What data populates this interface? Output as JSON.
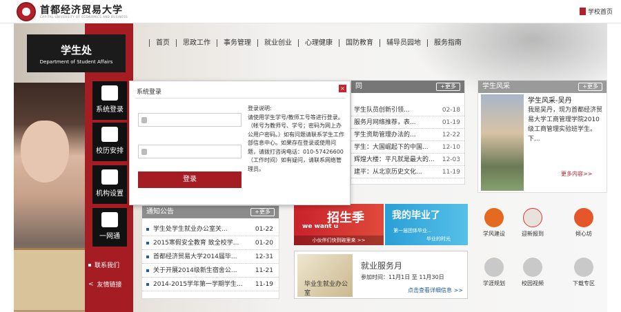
{
  "header": {
    "title": "首都经济贸易大学",
    "subtitle": "CAPITAL UNIVERSITY OF ECONOMICS AND BUSINESS",
    "home_link": "学校首页"
  },
  "dept": {
    "name_cn": "学生处",
    "name_en": "Department of Student Affairs"
  },
  "nav": [
    "首页",
    "思政工作",
    "事务管理",
    "就业创业",
    "心理健康",
    "国防教育",
    "辅导员园地",
    "服务指南"
  ],
  "side_menu": [
    {
      "label": "系统登录",
      "icon": "user-login-icon"
    },
    {
      "label": "校历安排",
      "icon": "calendar-icon"
    },
    {
      "label": "机构设置",
      "icon": "org-user-icon"
    },
    {
      "label": "一网通",
      "icon": "clover-icon"
    }
  ],
  "side_links": [
    "联系我们",
    "友情链接"
  ],
  "news": {
    "more": "+更多",
    "items": [
      {
        "title": "学生队员创新引领...",
        "date": "02-18"
      },
      {
        "title": "服务月网络推荐，表...",
        "date": "01-19"
      },
      {
        "title": "学生资助管理办法的...",
        "date": "12-22"
      },
      {
        "title": "学生：大国崛起下的中国...",
        "date": "12-10"
      },
      {
        "title": "辉煌大楼：平凡就是最大的...",
        "date": "12-03"
      },
      {
        "title": "建平：从北京历史文化...",
        "date": "11-19"
      }
    ]
  },
  "notice": {
    "title": "通知公告",
    "more": "+更多",
    "items": [
      {
        "title": "学生处学生就业办公室关...",
        "date": "01-22"
      },
      {
        "title": "2015寒假安全教育 致全校学...",
        "date": "01-20"
      },
      {
        "title": "首都经济贸易大学2014届毕...",
        "date": "12-31"
      },
      {
        "title": "关于开展2014级新生宿舍公...",
        "date": "11-21"
      },
      {
        "title": "2014-2015学年第一学期学生...",
        "date": "11-19"
      }
    ]
  },
  "profile": {
    "title": "学生风采",
    "more": "+更多",
    "name": "学生风采-吴丹",
    "text": "我是吴丹，现为首都经济贸易大学工商管理学院2010级工商管理实验班学生。下...",
    "link": "更多内容>>"
  },
  "banners": {
    "recruit_big": "招生季",
    "recruit_sm": "we want u",
    "recruit_bot": "小伙伴们快到碗里来 >>",
    "grad_big": "我的毕业了",
    "grad_sm": "第一届团体毕业...",
    "grad_sm2": "毕业的时光"
  },
  "job_fair": {
    "pic_text": "毕业生就业办公室",
    "title": "就业服务月",
    "when": "参加时间：11月1日 至 11月30日",
    "link": "点击查看详细信息 >>"
  },
  "tiles": [
    {
      "label": "学风建设",
      "icon": "pen-icon",
      "color": "#e36a1e"
    },
    {
      "label": "迎新报到",
      "icon": "welcome-icon",
      "color": "#e8e2dc"
    },
    {
      "label": "倾心坊",
      "icon": "heart-icon",
      "color": "#e5572b"
    },
    {
      "label": "学涯规划",
      "icon": "chart-icon",
      "color": "#c9c9c9"
    },
    {
      "label": "校园视频",
      "icon": "play-icon",
      "color": "#c9c9c9"
    },
    {
      "label": "下载专区",
      "icon": "download-icon",
      "color": "#c9c9c9"
    }
  ],
  "login": {
    "title": "系统登录",
    "close": "×",
    "username_placeholder": "",
    "password_placeholder": "",
    "button": "登录",
    "help_title": "登录说明:",
    "help_text": "请使用学生学号/教师工号等进行登录。（帐号为教师号、学号；密码为网上办公用户密码。）如有问题请联系学生工作部信息中心。如果存在登录或使用问题，请拨打咨询电话：010-57426600（工作时间）如有疑问，请联系网络管理员。"
  }
}
